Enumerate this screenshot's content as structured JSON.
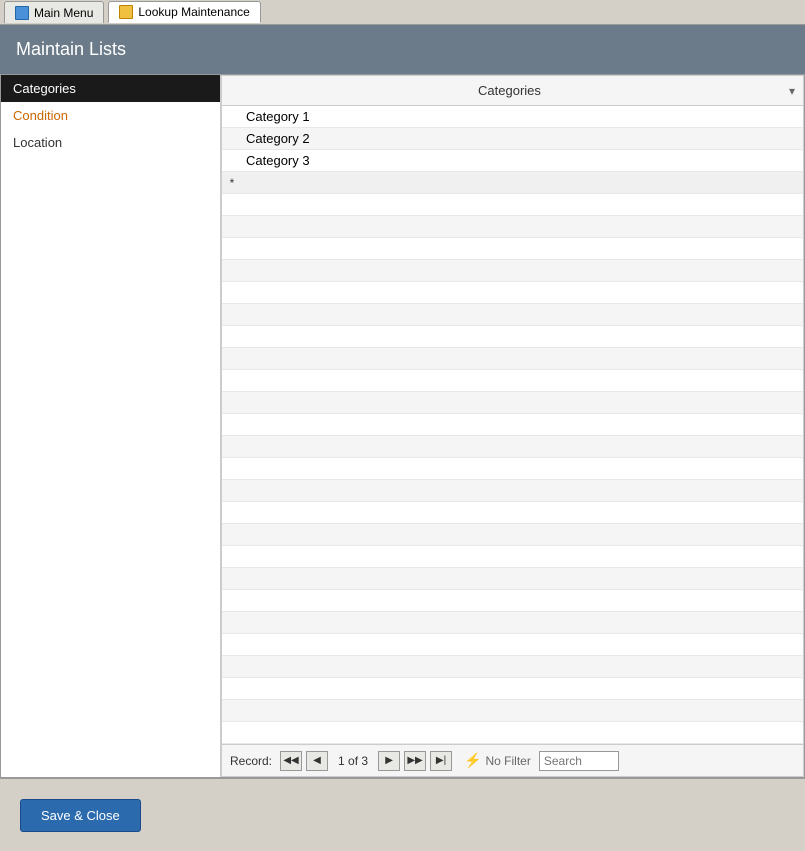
{
  "tabbar": {
    "main_menu_label": "Main Menu",
    "lookup_label": "Lookup Maintenance"
  },
  "page_header": {
    "title": "Maintain Lists"
  },
  "sidebar": {
    "items": [
      {
        "label": "Categories",
        "selected": true,
        "orange": false
      },
      {
        "label": "Condition",
        "selected": false,
        "orange": true
      },
      {
        "label": "Location",
        "selected": false,
        "orange": false
      }
    ]
  },
  "grid": {
    "column_header": "Categories",
    "rows": [
      {
        "value": "Category 1",
        "indicator": ""
      },
      {
        "value": "Category 2",
        "indicator": ""
      },
      {
        "value": "Category 3",
        "indicator": ""
      }
    ],
    "new_row_indicator": "*"
  },
  "navbar": {
    "record_label": "Record:",
    "first_label": "◀◀",
    "prev_label": "◀",
    "current": "1 of 3",
    "next_label": "▶",
    "last_label": "▶▶",
    "end_label": "▶|",
    "no_filter_label": "No Filter",
    "search_placeholder": "Search",
    "search_value": ""
  },
  "footer": {
    "save_close_label": "Save & Close"
  }
}
